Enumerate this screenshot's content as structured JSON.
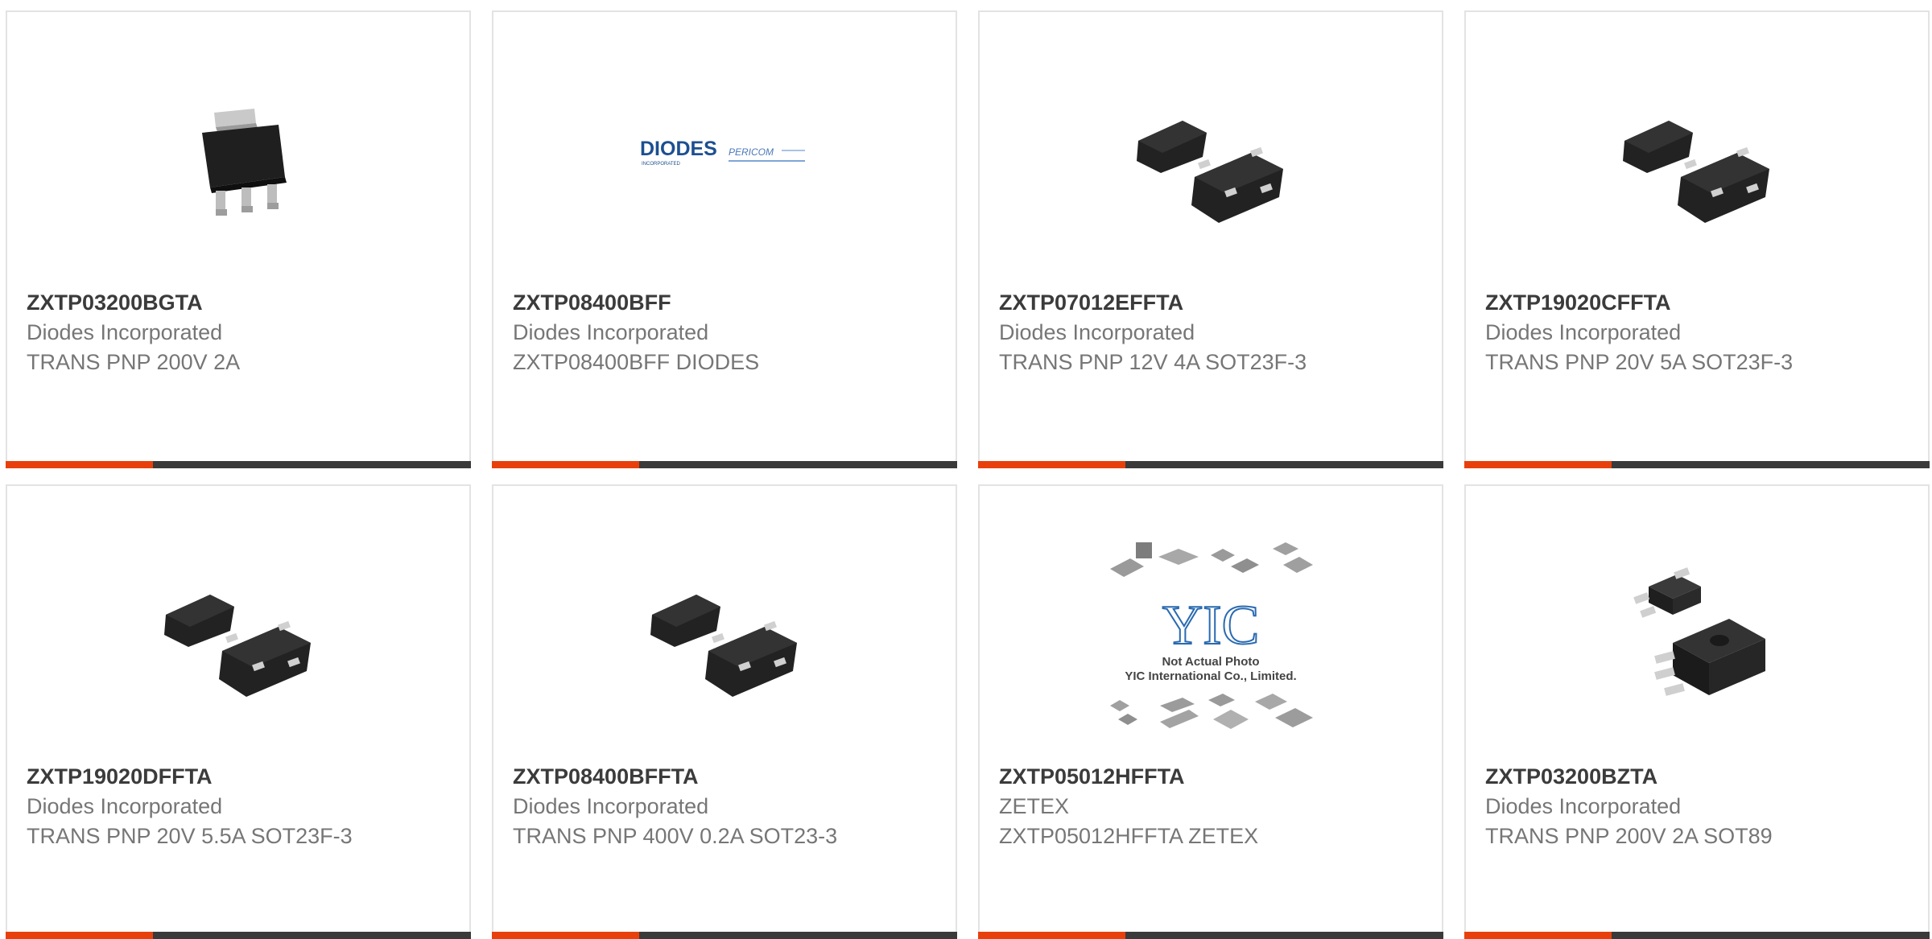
{
  "accent_color": "#e8400c",
  "bar_color": "#3a3a3a",
  "products": [
    {
      "part": "ZXTP03200BGTA",
      "manufacturer": "Diodes Incorporated",
      "description": "TRANS PNP 200V 2A",
      "image": "sot223-package-icon"
    },
    {
      "part": "ZXTP08400BFF",
      "manufacturer": "Diodes Incorporated",
      "description": "ZXTP08400BFF DIODES",
      "image": "diodes-pericom-logo",
      "logo": {
        "brand": "DIODES",
        "brand_sub": "INCORPORATED",
        "partner": "PERICOM"
      }
    },
    {
      "part": "ZXTP07012EFFTA",
      "manufacturer": "Diodes Incorporated",
      "description": "TRANS PNP 12V 4A SOT23F-3",
      "image": "sot23-package-icon"
    },
    {
      "part": "ZXTP19020CFFTA",
      "manufacturer": "Diodes Incorporated",
      "description": "TRANS PNP 20V 5A SOT23F-3",
      "image": "sot23-package-icon"
    },
    {
      "part": "ZXTP19020DFFTA",
      "manufacturer": "Diodes Incorporated",
      "description": "TRANS PNP 20V 5.5A SOT23F-3",
      "image": "sot23-package-icon"
    },
    {
      "part": "ZXTP08400BFFTA",
      "manufacturer": "Diodes Incorporated",
      "description": "TRANS PNP 400V 0.2A SOT23-3",
      "image": "sot23-package-icon"
    },
    {
      "part": "ZXTP05012HFFTA",
      "manufacturer": "ZETEX",
      "description": "ZXTP05012HFFTA ZETEX",
      "image": "not-actual-photo-placeholder",
      "placeholder": {
        "brand": "YIC",
        "line1": "Not Actual Photo",
        "line2": "YIC International Co., Limited."
      }
    },
    {
      "part": "ZXTP03200BZTA",
      "manufacturer": "Diodes Incorporated",
      "description": "TRANS PNP 200V 2A SOT89",
      "image": "sot89-package-icon"
    }
  ]
}
